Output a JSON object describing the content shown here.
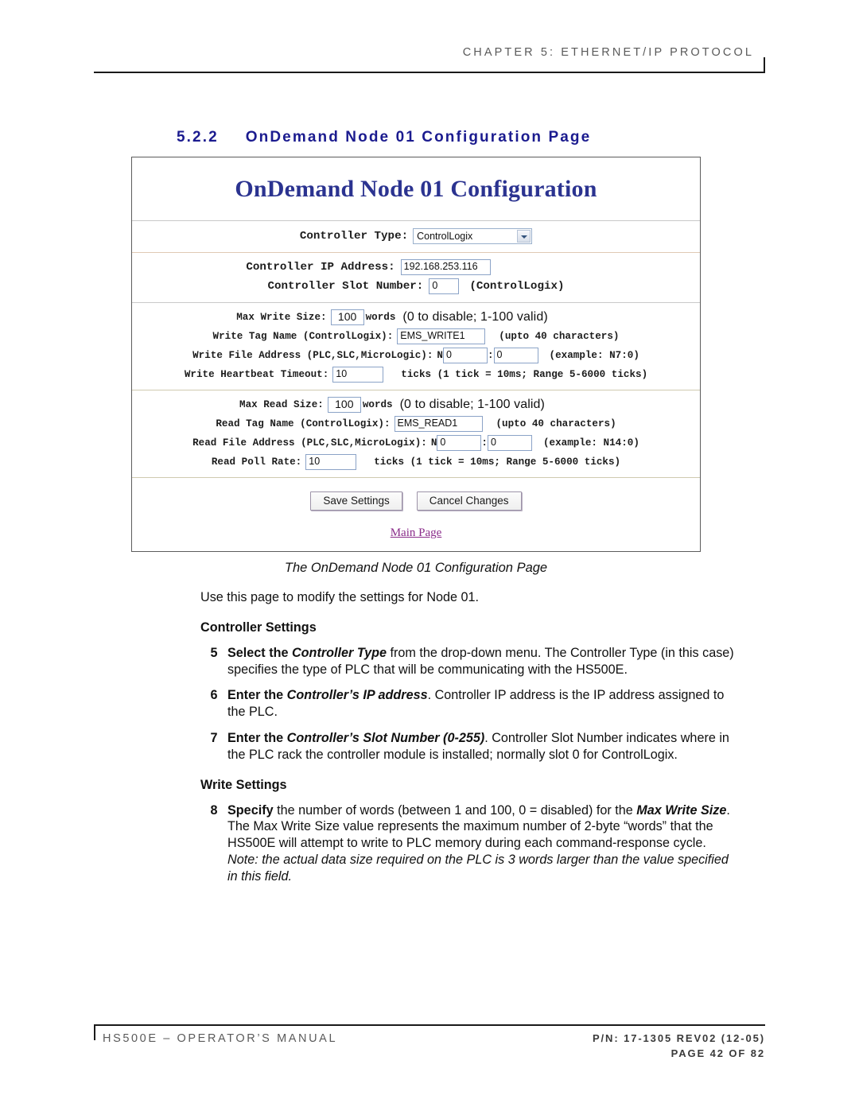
{
  "header": {
    "chapter": "CHAPTER 5: ETHERNET/IP PROTOCOL"
  },
  "section": {
    "number": "5.2.2",
    "title": "OnDemand Node 01 Configuration Page"
  },
  "screenshot": {
    "title": "OnDemand Node 01 Configuration",
    "controller": {
      "type_label": "Controller Type:",
      "type_value": "ControlLogix",
      "type_options": [
        "ControlLogix"
      ],
      "ip_label": "Controller IP Address:",
      "ip_value": "192.168.253.116",
      "slot_label": "Controller Slot Number:",
      "slot_value": "0",
      "slot_note": "(ControlLogix)"
    },
    "write": {
      "max_size_label": "Max Write Size:",
      "max_size_value": "100",
      "words_label": "words",
      "max_size_hint": "(0 to disable; 1-100 valid)",
      "tag_label": "Write Tag Name (ControlLogix):",
      "tag_value": "EMS_WRITE1",
      "tag_hint": "(upto 40 characters)",
      "file_label": "Write File Address (PLC,SLC,MicroLogic):",
      "file_prefix": "N",
      "file_value": "0",
      "file_colon": ":",
      "file_offset": "0",
      "file_hint": "(example: N7:0)",
      "heartbeat_label": "Write Heartbeat Timeout:",
      "heartbeat_value": "10",
      "heartbeat_hint": "ticks (1 tick = 10ms; Range 5-6000 ticks)"
    },
    "read": {
      "max_size_label": "Max Read Size:",
      "max_size_value": "100",
      "words_label": "words",
      "max_size_hint": "(0 to disable; 1-100 valid)",
      "tag_label": "Read Tag Name (ControlLogix):",
      "tag_value": "EMS_READ1",
      "tag_hint": "(upto 40 characters)",
      "file_label": "Read File Address (PLC,SLC,MicroLogix):",
      "file_prefix": "N",
      "file_value": "0",
      "file_colon": ":",
      "file_offset": "0",
      "file_hint": "(example: N14:0)",
      "poll_label": "Read Poll Rate:",
      "poll_value": "10",
      "poll_hint": "ticks (1 tick = 10ms; Range 5-6000 ticks)"
    },
    "actions": {
      "save_label": "Save Settings",
      "cancel_label": "Cancel Changes",
      "main_page_link": "Main Page"
    },
    "colors": {
      "title_blue": "#2b3390",
      "link_purple": "#8a2b8a",
      "input_border": "#8ba3c7"
    }
  },
  "caption": "The OnDemand Node 01 Configuration Page",
  "intro": "Use this page to modify the settings for Node 01.",
  "controller_settings": {
    "heading": "Controller Settings",
    "items": [
      {
        "number": "5",
        "lead": "Select",
        "mid1": " the ",
        "emph": "Controller Type",
        "rest": " from the drop-down menu. The Controller Type (in this case) specifies the type of PLC that will be communicating with the HS500E."
      },
      {
        "number": "6",
        "lead": "Enter",
        "mid1": " the ",
        "emph": "Controller’s IP address",
        "rest": ". Controller IP address is the IP address assigned to the PLC."
      },
      {
        "number": "7",
        "lead": "Enter",
        "mid1": " the ",
        "emph": "Controller’s Slot Number (0-255)",
        "rest": ". Controller Slot Number indicates where in the PLC rack the controller module is installed; normally slot 0 for ControlLogix."
      }
    ]
  },
  "write_settings": {
    "heading": "Write Settings",
    "items": [
      {
        "number": "8",
        "lead": "Specify",
        "mid1": " the number of words (between 1 and 100, 0 = disabled) for the ",
        "emph": "Max Write Size",
        "rest": ". The Max Write Size value represents the maximum number of 2-byte “words” that the HS500E will attempt to write to PLC memory during each command-response cycle. ",
        "note": "Note: the actual data size required on the PLC is 3 words larger than the value specified in this field."
      }
    ]
  },
  "footer": {
    "left": "HS500E – OPERATOR’S MANUAL",
    "pn": "P/N: 17-1305 REV02 (12-05)",
    "page": "PAGE 42 OF 82"
  }
}
